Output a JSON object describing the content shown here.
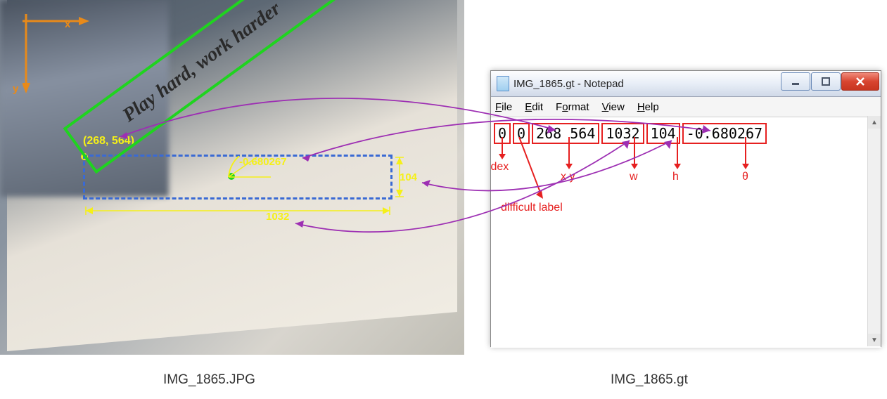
{
  "left": {
    "image_caption": "IMG_1865.JPG",
    "axis_x": "x",
    "axis_y": "y",
    "anchor_coord": "(268, 564)",
    "rotated_text": "Play hard, work harder",
    "angle_value": "-0.680267",
    "width_value": "1032",
    "height_value": "104"
  },
  "notepad": {
    "title": "IMG_1865.gt - Notepad",
    "menu": {
      "file": "File",
      "edit": "Edit",
      "format": "Format",
      "view": "View",
      "help": "Help"
    },
    "fields": {
      "index": "0",
      "difficult": "0",
      "xy": "268  564",
      "w": "1032",
      "h": "104",
      "theta": "-0.680267"
    },
    "annotations": {
      "index": "index",
      "difficult": "difficult label",
      "xy": "x y",
      "w": "w",
      "h": "h",
      "theta": "θ"
    },
    "caption": "IMG_1865.gt"
  }
}
